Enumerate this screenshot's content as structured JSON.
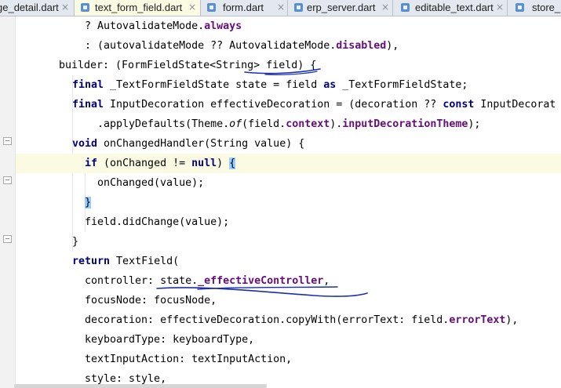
{
  "tabs": [
    {
      "label": "ge_detail.dart",
      "active": false
    },
    {
      "label": "text_form_field.dart",
      "active": true
    },
    {
      "label": "form.dart",
      "active": false
    },
    {
      "label": "erp_server.dart",
      "active": false
    },
    {
      "label": "editable_text.dart",
      "active": false
    },
    {
      "label": "store_",
      "active": false
    }
  ],
  "close_glyph": "×",
  "editor": {
    "line1": {
      "a": "? AutovalidateMode.",
      "b": "always"
    },
    "line2": {
      "a": ": (autovalidateMode ?? AutovalidateMode.",
      "b": "disabled",
      "c": "),"
    },
    "line3": {
      "a": "builder: (FormFieldState<String> field) {"
    },
    "line4": {
      "kw": "final",
      "a": " _TextFormFieldState state = field ",
      "kw2": "as",
      "b": " _TextFormFieldState;"
    },
    "line5": {
      "kw": "final",
      "a": " InputDecoration effectiveDecoration = (decoration ?? ",
      "kw2": "const",
      "b": " InputDecorat"
    },
    "line6": {
      "a": ".applyDefaults(Theme.",
      "it": "of",
      "b": "(field.",
      "c": "context",
      "d": ").",
      "e": "inputDecorationTheme",
      "f": ");"
    },
    "line7": {
      "kw": "void",
      "a": " onChangedHandler(String value) {"
    },
    "line8": {
      "kw": "if",
      "a": " (onChanged != ",
      "kw2": "null",
      "b": ") ",
      "brace": "{"
    },
    "line9": {
      "a": "onChanged(value);"
    },
    "line10": {
      "brace": "}"
    },
    "line11": {
      "a": "field.didChange(value);"
    },
    "line12": {
      "a": "}"
    },
    "line13": {
      "kw": "return",
      "a": " TextField("
    },
    "line14": {
      "a": "controller: state.",
      "b": "_effectiveController",
      "c": ","
    },
    "line15": {
      "a": "focusNode: focusNode,"
    },
    "line16": {
      "a": "decoration: effectiveDecoration.copyWith(errorText: field.",
      "b": "errorText",
      "c": "),"
    },
    "line17": {
      "a": "keyboardType: keyboardType,"
    },
    "line18": {
      "a": "textInputAction: textInputAction,"
    },
    "line19": {
      "a": "style: style,"
    }
  },
  "colors": {
    "keyword": "#000080",
    "field": "#660e7a",
    "current_line": "#fbfbe4",
    "brace_match": "#99ccff",
    "annotation_ink": "#1a2fb0"
  }
}
